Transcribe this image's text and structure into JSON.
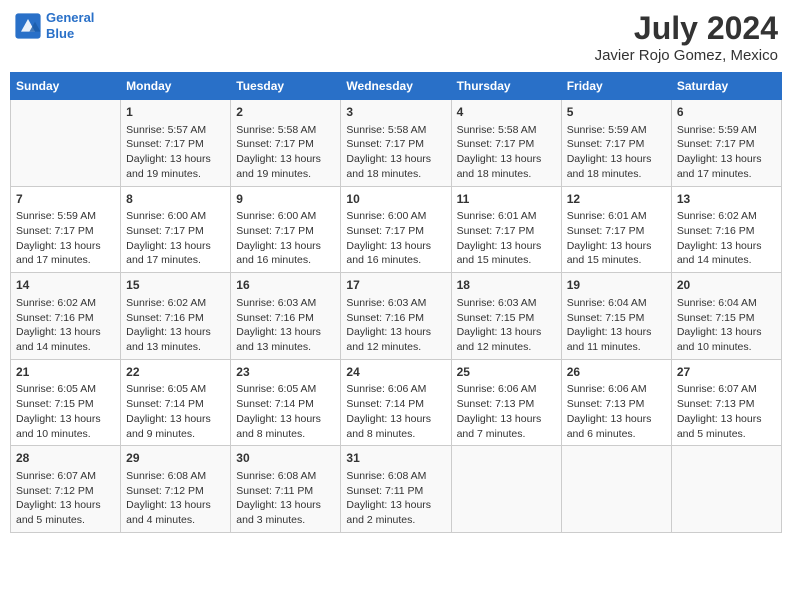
{
  "header": {
    "logo_line1": "General",
    "logo_line2": "Blue",
    "title": "July 2024",
    "subtitle": "Javier Rojo Gomez, Mexico"
  },
  "days_of_week": [
    "Sunday",
    "Monday",
    "Tuesday",
    "Wednesday",
    "Thursday",
    "Friday",
    "Saturday"
  ],
  "weeks": [
    [
      {
        "day": "",
        "info": ""
      },
      {
        "day": "1",
        "info": "Sunrise: 5:57 AM\nSunset: 7:17 PM\nDaylight: 13 hours\nand 19 minutes."
      },
      {
        "day": "2",
        "info": "Sunrise: 5:58 AM\nSunset: 7:17 PM\nDaylight: 13 hours\nand 19 minutes."
      },
      {
        "day": "3",
        "info": "Sunrise: 5:58 AM\nSunset: 7:17 PM\nDaylight: 13 hours\nand 18 minutes."
      },
      {
        "day": "4",
        "info": "Sunrise: 5:58 AM\nSunset: 7:17 PM\nDaylight: 13 hours\nand 18 minutes."
      },
      {
        "day": "5",
        "info": "Sunrise: 5:59 AM\nSunset: 7:17 PM\nDaylight: 13 hours\nand 18 minutes."
      },
      {
        "day": "6",
        "info": "Sunrise: 5:59 AM\nSunset: 7:17 PM\nDaylight: 13 hours\nand 17 minutes."
      }
    ],
    [
      {
        "day": "7",
        "info": "Sunrise: 5:59 AM\nSunset: 7:17 PM\nDaylight: 13 hours\nand 17 minutes."
      },
      {
        "day": "8",
        "info": "Sunrise: 6:00 AM\nSunset: 7:17 PM\nDaylight: 13 hours\nand 17 minutes."
      },
      {
        "day": "9",
        "info": "Sunrise: 6:00 AM\nSunset: 7:17 PM\nDaylight: 13 hours\nand 16 minutes."
      },
      {
        "day": "10",
        "info": "Sunrise: 6:00 AM\nSunset: 7:17 PM\nDaylight: 13 hours\nand 16 minutes."
      },
      {
        "day": "11",
        "info": "Sunrise: 6:01 AM\nSunset: 7:17 PM\nDaylight: 13 hours\nand 15 minutes."
      },
      {
        "day": "12",
        "info": "Sunrise: 6:01 AM\nSunset: 7:17 PM\nDaylight: 13 hours\nand 15 minutes."
      },
      {
        "day": "13",
        "info": "Sunrise: 6:02 AM\nSunset: 7:16 PM\nDaylight: 13 hours\nand 14 minutes."
      }
    ],
    [
      {
        "day": "14",
        "info": "Sunrise: 6:02 AM\nSunset: 7:16 PM\nDaylight: 13 hours\nand 14 minutes."
      },
      {
        "day": "15",
        "info": "Sunrise: 6:02 AM\nSunset: 7:16 PM\nDaylight: 13 hours\nand 13 minutes."
      },
      {
        "day": "16",
        "info": "Sunrise: 6:03 AM\nSunset: 7:16 PM\nDaylight: 13 hours\nand 13 minutes."
      },
      {
        "day": "17",
        "info": "Sunrise: 6:03 AM\nSunset: 7:16 PM\nDaylight: 13 hours\nand 12 minutes."
      },
      {
        "day": "18",
        "info": "Sunrise: 6:03 AM\nSunset: 7:15 PM\nDaylight: 13 hours\nand 12 minutes."
      },
      {
        "day": "19",
        "info": "Sunrise: 6:04 AM\nSunset: 7:15 PM\nDaylight: 13 hours\nand 11 minutes."
      },
      {
        "day": "20",
        "info": "Sunrise: 6:04 AM\nSunset: 7:15 PM\nDaylight: 13 hours\nand 10 minutes."
      }
    ],
    [
      {
        "day": "21",
        "info": "Sunrise: 6:05 AM\nSunset: 7:15 PM\nDaylight: 13 hours\nand 10 minutes."
      },
      {
        "day": "22",
        "info": "Sunrise: 6:05 AM\nSunset: 7:14 PM\nDaylight: 13 hours\nand 9 minutes."
      },
      {
        "day": "23",
        "info": "Sunrise: 6:05 AM\nSunset: 7:14 PM\nDaylight: 13 hours\nand 8 minutes."
      },
      {
        "day": "24",
        "info": "Sunrise: 6:06 AM\nSunset: 7:14 PM\nDaylight: 13 hours\nand 8 minutes."
      },
      {
        "day": "25",
        "info": "Sunrise: 6:06 AM\nSunset: 7:13 PM\nDaylight: 13 hours\nand 7 minutes."
      },
      {
        "day": "26",
        "info": "Sunrise: 6:06 AM\nSunset: 7:13 PM\nDaylight: 13 hours\nand 6 minutes."
      },
      {
        "day": "27",
        "info": "Sunrise: 6:07 AM\nSunset: 7:13 PM\nDaylight: 13 hours\nand 5 minutes."
      }
    ],
    [
      {
        "day": "28",
        "info": "Sunrise: 6:07 AM\nSunset: 7:12 PM\nDaylight: 13 hours\nand 5 minutes."
      },
      {
        "day": "29",
        "info": "Sunrise: 6:08 AM\nSunset: 7:12 PM\nDaylight: 13 hours\nand 4 minutes."
      },
      {
        "day": "30",
        "info": "Sunrise: 6:08 AM\nSunset: 7:11 PM\nDaylight: 13 hours\nand 3 minutes."
      },
      {
        "day": "31",
        "info": "Sunrise: 6:08 AM\nSunset: 7:11 PM\nDaylight: 13 hours\nand 2 minutes."
      },
      {
        "day": "",
        "info": ""
      },
      {
        "day": "",
        "info": ""
      },
      {
        "day": "",
        "info": ""
      }
    ]
  ]
}
